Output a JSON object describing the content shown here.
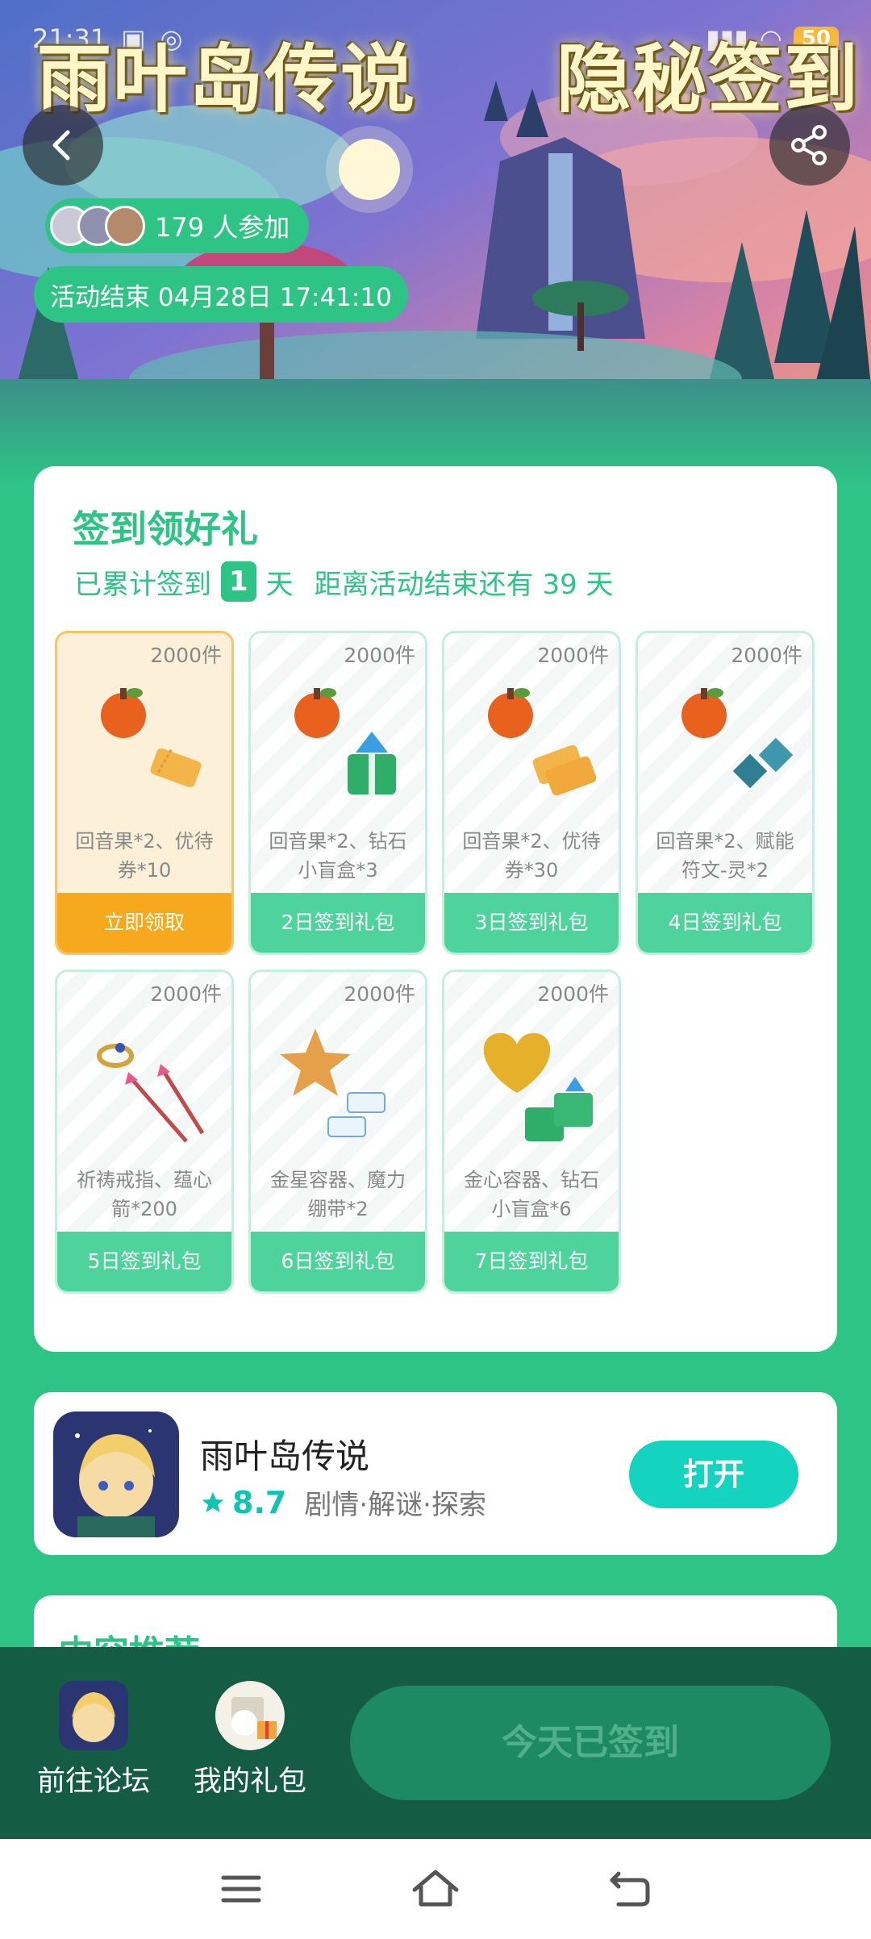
{
  "status": {
    "time": "21:31",
    "battery": "50"
  },
  "banner": {
    "game_title": "雨叶岛传说",
    "event_title": "隐秘签到",
    "participants": "179 人参加",
    "end_time": "活动结束 04月28日 17:41:10"
  },
  "sign": {
    "title": "签到领好礼",
    "prefix": "已累计签到",
    "days": "1",
    "day_unit": "天",
    "remain": "距离活动结束还有 39 天",
    "gifts": [
      {
        "count": "2000件",
        "desc": "回音果*2、优待券*10",
        "label": "立即领取"
      },
      {
        "count": "2000件",
        "desc": "回音果*2、钻石小盲盒*3",
        "label": "2日签到礼包"
      },
      {
        "count": "2000件",
        "desc": "回音果*2、优待券*30",
        "label": "3日签到礼包"
      },
      {
        "count": "2000件",
        "desc": "回音果*2、赋能符文-灵*2",
        "label": "4日签到礼包"
      },
      {
        "count": "2000件",
        "desc": "祈祷戒指、蕴心箭*200",
        "label": "5日签到礼包"
      },
      {
        "count": "2000件",
        "desc": "金星容器、魔力绷带*2",
        "label": "6日签到礼包"
      },
      {
        "count": "2000件",
        "desc": "金心容器、钻石小盲盒*6",
        "label": "7日签到礼包"
      }
    ]
  },
  "app": {
    "name": "雨叶岛传说",
    "rating": "8.7",
    "tags": "剧情·解谜·探索",
    "open_label": "打开"
  },
  "peek": {
    "title": "内容推荐"
  },
  "action_bar": {
    "forum_label": "前往论坛",
    "gifts_label": "我的礼包",
    "signed_label": "今天已签到"
  },
  "colors": {
    "accent": "#2ec486",
    "active": "#f7a91e",
    "open": "#14d3bf",
    "dark": "#145c44"
  }
}
